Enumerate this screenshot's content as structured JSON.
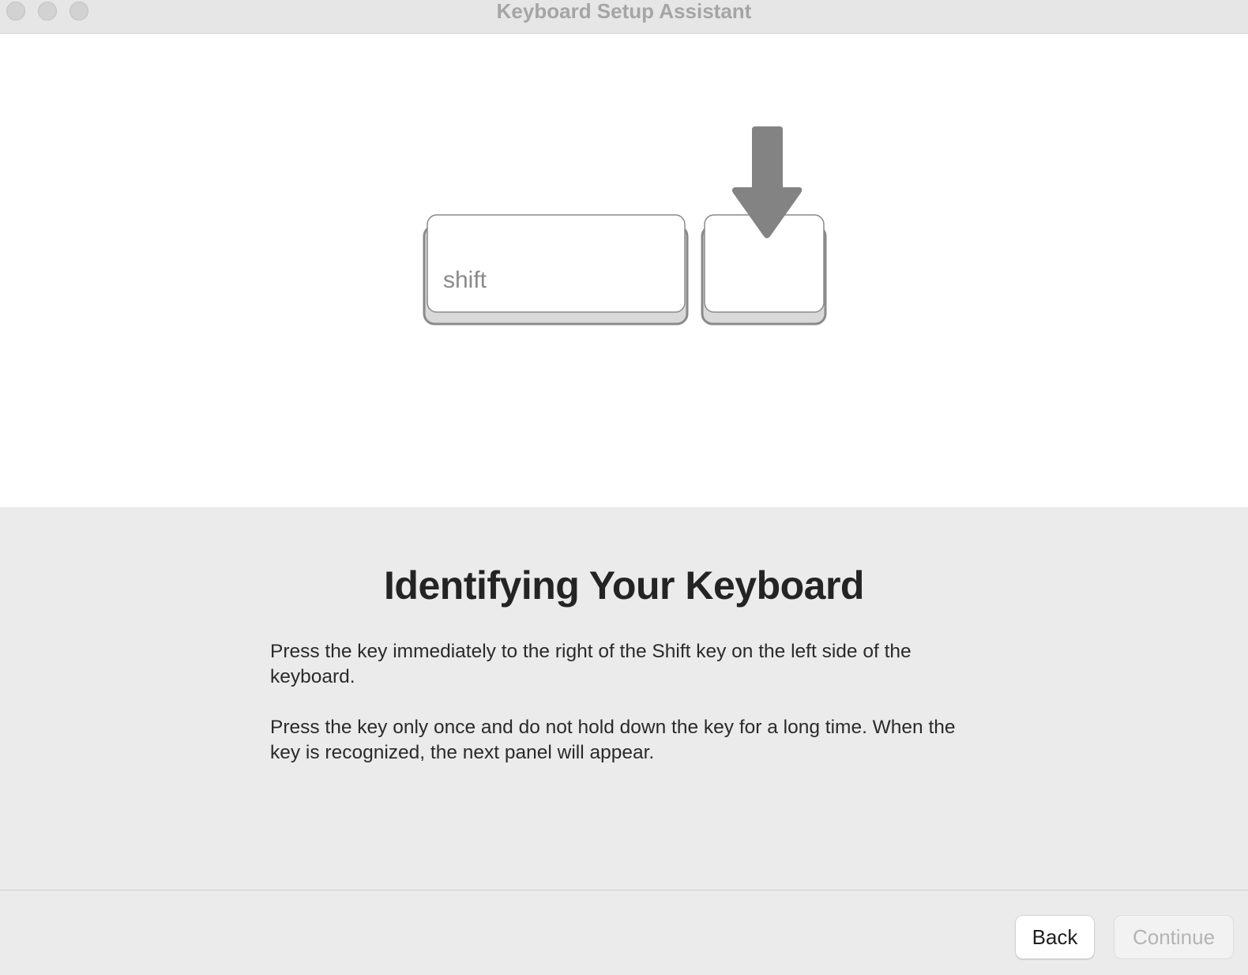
{
  "window": {
    "title": "Keyboard Setup Assistant",
    "controls": [
      "close",
      "minimize",
      "zoom"
    ]
  },
  "illustration": {
    "key_labels": [
      "shift",
      ""
    ],
    "arrow_icon": "down-arrow-icon",
    "colors": {
      "arrow": "#838383",
      "key_border": "#8a8a8a",
      "key_base": "#d9d9d9"
    }
  },
  "content": {
    "heading": "Identifying Your Keyboard",
    "paragraphs": [
      "Press the key immediately to the right of the Shift key on the left side of the keyboard.",
      "Press the key only once and do not hold down the key for a long time. When the key is recognized, the next panel will appear."
    ]
  },
  "footer": {
    "back_label": "Back",
    "continue_label": "Continue",
    "continue_enabled": false
  }
}
